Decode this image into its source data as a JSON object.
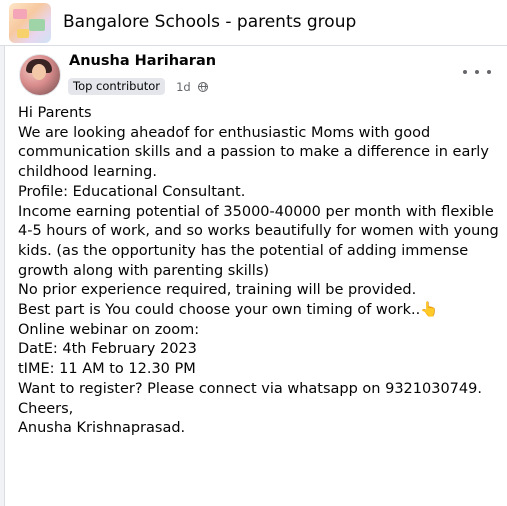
{
  "group": {
    "title": "Bangalore Schools - parents group"
  },
  "post": {
    "author": "Anusha Hariharan",
    "badge": "Top contributor",
    "time": "1d",
    "visibility_icon": "globe-icon",
    "more_icon": "more-horizontal-icon",
    "body_lines": [
      "Hi Parents",
      "We are looking aheadof for enthusiastic Moms with good communication skills and a passion to make a difference in early childhood learning.",
      "Profile: Educational Consultant.",
      "Income earning potential of 35000-40000 per month with flexible 4-5 hours of work, and so works beautifully for women with young kids. (as the opportunity has the potential of adding immense growth along with parenting skills)",
      "No prior experience required, training will be provided.",
      "Best part is You could choose your own timing of work..👆",
      "Online webinar on zoom:",
      "DatE: 4th February 2023",
      "tIME: 11 AM to 12.30 PM",
      "Want to register? Please connect via whatsapp on 9321030749.",
      "Cheers,",
      "Anusha Krishnaprasad."
    ]
  },
  "colors": {
    "background": "#f0f2f5",
    "card": "#ffffff",
    "text": "#050505",
    "secondary_text": "#65676b",
    "badge_bg": "#e4e6eb"
  }
}
